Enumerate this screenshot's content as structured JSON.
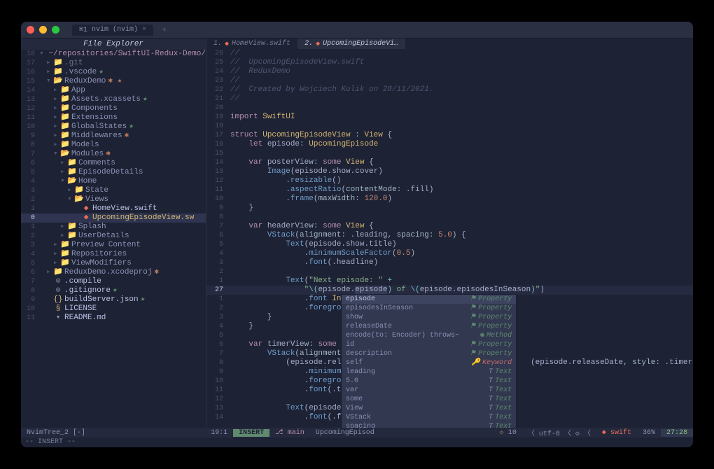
{
  "titlebar": {
    "app": "nvim (nvim)",
    "tab_index": "⌘1"
  },
  "sidebar": {
    "title": "File Explorer",
    "root": "~/repositories/SwiftUI-Redux-Demo/"
  },
  "tree": [
    {
      "n": "18",
      "d": 0,
      "a": "▾",
      "i": "",
      "lbl": "~/repositories/SwiftUI-Redux-Demo/",
      "cls": "root"
    },
    {
      "n": "17",
      "d": 1,
      "a": "▸",
      "i": "📁",
      "lbl": ".git",
      "cls": "git"
    },
    {
      "n": "16",
      "d": 1,
      "a": "▸",
      "i": "📁",
      "lbl": ".vscode",
      "st": "★"
    },
    {
      "n": "15",
      "d": 1,
      "a": "▾",
      "i": "📂",
      "lbl": "ReduxDemo",
      "st": "✱ ★",
      "io": true
    },
    {
      "n": "14",
      "d": 2,
      "a": "▸",
      "i": "📁",
      "lbl": "App"
    },
    {
      "n": "13",
      "d": 2,
      "a": "▸",
      "i": "📁",
      "lbl": "Assets.xcassets",
      "st": "★"
    },
    {
      "n": "12",
      "d": 2,
      "a": "▸",
      "i": "📁",
      "lbl": "Components"
    },
    {
      "n": "11",
      "d": 2,
      "a": "▸",
      "i": "📁",
      "lbl": "Extensions"
    },
    {
      "n": "10",
      "d": 2,
      "a": "▸",
      "i": "📁",
      "lbl": "GlobalStates",
      "st": "★"
    },
    {
      "n": "9",
      "d": 2,
      "a": "▸",
      "i": "📁",
      "lbl": "Middlewares",
      "st": "✱"
    },
    {
      "n": "8",
      "d": 2,
      "a": "▸",
      "i": "📁",
      "lbl": "Models"
    },
    {
      "n": "7",
      "d": 2,
      "a": "▾",
      "i": "📂",
      "lbl": "Modules",
      "st": "✱",
      "io": true
    },
    {
      "n": "6",
      "d": 3,
      "a": "▸",
      "i": "📁",
      "lbl": "Comments"
    },
    {
      "n": "5",
      "d": 3,
      "a": "▸",
      "i": "📁",
      "lbl": "EpisodeDetails"
    },
    {
      "n": "4",
      "d": 3,
      "a": "▾",
      "i": "📂",
      "lbl": "Home",
      "io": true
    },
    {
      "n": "3",
      "d": 4,
      "a": "▸",
      "i": "📁",
      "lbl": "State"
    },
    {
      "n": "2",
      "d": 4,
      "a": "▾",
      "i": "📂",
      "lbl": "Views",
      "io": true
    },
    {
      "n": "1",
      "d": 5,
      "a": "",
      "i": "◆",
      "lbl": "HomeView.swift",
      "cls": "file",
      "ic": "sw"
    },
    {
      "n": "0",
      "d": 5,
      "a": "",
      "i": "◆",
      "lbl": "UpcomingEpisodeView.sw",
      "cls": "file sel",
      "ic": "sw",
      "sel": true
    },
    {
      "n": "1",
      "d": 3,
      "a": "▸",
      "i": "📁",
      "lbl": "Splash"
    },
    {
      "n": "2",
      "d": 3,
      "a": "▸",
      "i": "📁",
      "lbl": "UserDetails"
    },
    {
      "n": "3",
      "d": 2,
      "a": "▸",
      "i": "📁",
      "lbl": "Preview Content"
    },
    {
      "n": "4",
      "d": 2,
      "a": "▸",
      "i": "📁",
      "lbl": "Repositories"
    },
    {
      "n": "5",
      "d": 2,
      "a": "▸",
      "i": "📁",
      "lbl": "ViewModifiers"
    },
    {
      "n": "6",
      "d": 1,
      "a": "▸",
      "i": "📁",
      "lbl": "ReduxDemo.xcodeproj",
      "st": "✱"
    },
    {
      "n": "7",
      "d": 1,
      "a": "",
      "i": "⚙",
      "lbl": ".compile",
      "cls": "file",
      "ic": "gear"
    },
    {
      "n": "8",
      "d": 1,
      "a": "",
      "i": "⚙",
      "lbl": ".gitignore",
      "cls": "file",
      "ic": "gear",
      "st": "★"
    },
    {
      "n": "9",
      "d": 1,
      "a": "",
      "i": "{}",
      "lbl": "buildServer.json",
      "cls": "file",
      "ic": "js",
      "st": "★"
    },
    {
      "n": "10",
      "d": 1,
      "a": "",
      "i": "§",
      "lbl": "LICENSE",
      "cls": "file",
      "ic": "lic"
    },
    {
      "n": "11",
      "d": 1,
      "a": "",
      "i": "▾",
      "lbl": "README.md",
      "cls": "file",
      "ic": "md"
    }
  ],
  "tabs": [
    {
      "n": "1.",
      "ico": "◆",
      "lbl": "HomeView.swift"
    },
    {
      "n": "2.",
      "ico": "◆",
      "lbl": "UpcomingEpisodeVi…",
      "active": true
    }
  ],
  "code": [
    {
      "n": "26",
      "html": "<span class='cmt'>//</span>"
    },
    {
      "n": "25",
      "html": "<span class='cmt'>//  UpcomingEpisodeView.swift</span>"
    },
    {
      "n": "24",
      "html": "<span class='cmt'>//  ReduxDemo</span>"
    },
    {
      "n": "23",
      "html": "<span class='cmt'>//</span>"
    },
    {
      "n": "22",
      "html": "<span class='cmt'>//  Created by Wojciech Kulik on 28/11/2021.</span>"
    },
    {
      "n": "21",
      "html": "<span class='cmt'>//</span>"
    },
    {
      "n": "20",
      "html": ""
    },
    {
      "n": "19",
      "html": "<span class='kw'>import</span> <span class='typ'>SwiftUI</span>"
    },
    {
      "n": "18",
      "html": ""
    },
    {
      "n": "17",
      "html": "<span class='kw'>struct</span> <span class='typ'>UpcomingEpisodeView</span> <span class='op'>:</span> <span class='typ'>View</span> {"
    },
    {
      "n": "16",
      "html": "    <span class='kw'>let</span> episode<span class='op'>:</span> <span class='typ'>UpcomingEpisode</span>"
    },
    {
      "n": "15",
      "html": ""
    },
    {
      "n": "14",
      "html": "    <span class='kw'>var</span> posterView<span class='op'>:</span> <span class='kw'>some</span> <span class='typ'>View</span> {"
    },
    {
      "n": "13",
      "html": "        <span class='fn'>Image</span>(episode.show.cover)"
    },
    {
      "n": "12",
      "html": "            .<span class='fn'>resizable</span>()"
    },
    {
      "n": "11",
      "html": "            .<span class='fn'>aspectRatio</span>(<span class='prm'>contentMode</span>: .fill)"
    },
    {
      "n": "10",
      "html": "            .<span class='fn'>frame</span>(<span class='prm'>maxWidth</span>: <span class='num'>120.0</span>)"
    },
    {
      "n": "9",
      "html": "    }"
    },
    {
      "n": "8",
      "html": ""
    },
    {
      "n": "7",
      "html": "    <span class='kw'>var</span> headerView<span class='op'>:</span> <span class='kw'>some</span> <span class='typ'>View</span> {"
    },
    {
      "n": "6",
      "html": "        <span class='fn'>VStack</span>(<span class='prm'>alignment</span>: .leading, <span class='prm'>spacing</span>: <span class='num'>5.0</span>) {"
    },
    {
      "n": "5",
      "html": "            <span class='fn'>Text</span>(episode.show.title)"
    },
    {
      "n": "4",
      "html": "                .<span class='fn'>minimumScaleFactor</span>(<span class='num'>0.5</span>)"
    },
    {
      "n": "3",
      "html": "                .<span class='fn'>font</span>(.headline)"
    },
    {
      "n": "2",
      "html": ""
    },
    {
      "n": "1",
      "html": "            <span class='fn'>Text</span>(<span class='str'>\"Next episode: \"</span> <span class='op'>+</span>"
    },
    {
      "n": "27",
      "cur": true,
      "html": "                <span class='str'>\"</span><span class='op'>\\(</span>episode.<span class='cursor-line-bg'>episode</span><span class='op'>)</span><span class='str'> of </span><span class='op'>\\(</span>episode.episodesInSeason<span class='op'>)</span><span class='str'>\"</span>)"
    },
    {
      "n": "1",
      "html": "                .<span class='fn'>font</span> <span class='typ'>Int</span>"
    },
    {
      "n": "2",
      "html": "                .<span class='fn'>foregroun</span>"
    },
    {
      "n": "3",
      "html": "        }"
    },
    {
      "n": "4",
      "html": "    }"
    },
    {
      "n": "5",
      "html": ""
    },
    {
      "n": "6",
      "html": "    <span class='kw'>var</span> timerView<span class='op'>:</span> <span class='kw'>some</span> <span class='typ'>Vi</span>"
    },
    {
      "n": "7",
      "html": "        <span class='fn'>VStack</span>(<span class='prm'>alignment</span>:"
    },
    {
      "n": "8",
      "html": "            (episode.relea                                       (episode.releaseDate, <span class='prm'>style</span>: .timer))"
    },
    {
      "n": "9",
      "html": "                .<span class='fn'>minimumSc</span>"
    },
    {
      "n": "10",
      "html": "                .<span class='fn'>foregroun</span>"
    },
    {
      "n": "11",
      "html": "                .<span class='fn'>font</span>(.tit"
    },
    {
      "n": "12",
      "html": ""
    },
    {
      "n": "13",
      "html": "            <span class='fn'>Text</span>(episode.r"
    },
    {
      "n": "14",
      "html": "                .<span class='fn'>font</span>(.foo"
    }
  ],
  "popup": [
    {
      "lbl": "episode",
      "kind": "Property",
      "sel": true,
      "ico": "⚑"
    },
    {
      "lbl": "episodesInSeason",
      "kind": "Property",
      "ico": "⚑"
    },
    {
      "lbl": "show",
      "kind": "Property",
      "ico": "⚑"
    },
    {
      "lbl": "releaseDate",
      "kind": "Property",
      "ico": "⚑"
    },
    {
      "lbl": "encode(to: Encoder) throws~",
      "kind": "Method",
      "ico": "◉"
    },
    {
      "lbl": "id",
      "kind": "Property",
      "ico": "⚑"
    },
    {
      "lbl": "description",
      "kind": "Property",
      "ico": "⚑"
    },
    {
      "lbl": "self",
      "kind": "Keyword",
      "ico": "🔑",
      "kcls": "kw"
    },
    {
      "lbl": "leading",
      "kind": "Text",
      "ico": "T",
      "kcls": "tx"
    },
    {
      "lbl": "5.0",
      "kind": "Text",
      "ico": "T",
      "kcls": "tx"
    },
    {
      "lbl": "var",
      "kind": "Text",
      "ico": "T",
      "kcls": "tx"
    },
    {
      "lbl": "some",
      "kind": "Text",
      "ico": "T",
      "kcls": "tx"
    },
    {
      "lbl": "View",
      "kind": "Text",
      "ico": "T",
      "kcls": "tx"
    },
    {
      "lbl": "VStack",
      "kind": "Text",
      "ico": "T",
      "kcls": "tx"
    },
    {
      "lbl": "spacing",
      "kind": "Text",
      "ico": "T",
      "kcls": "tx"
    }
  ],
  "status": {
    "left_name": "NvimTree_2",
    "left_flag": "[-]",
    "left_pos": "19:1",
    "mode": "INSERT",
    "branch": "main",
    "file": "UpcomingEpisod",
    "diag": "10",
    "enc": "utf-8",
    "ft": "swift",
    "pct": "36%",
    "pos": "27:28",
    "cmd": "-- INSERT --"
  }
}
